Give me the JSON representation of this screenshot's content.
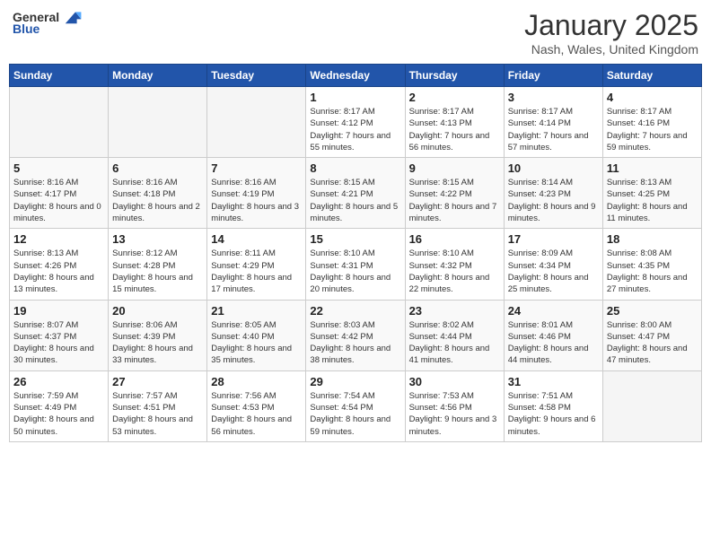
{
  "header": {
    "logo_general": "General",
    "logo_blue": "Blue",
    "month": "January 2025",
    "location": "Nash, Wales, United Kingdom"
  },
  "weekdays": [
    "Sunday",
    "Monday",
    "Tuesday",
    "Wednesday",
    "Thursday",
    "Friday",
    "Saturday"
  ],
  "weeks": [
    [
      {
        "day": "",
        "empty": true
      },
      {
        "day": "",
        "empty": true
      },
      {
        "day": "",
        "empty": true
      },
      {
        "day": "1",
        "sunrise": "8:17 AM",
        "sunset": "4:12 PM",
        "daylight": "7 hours and 55 minutes."
      },
      {
        "day": "2",
        "sunrise": "8:17 AM",
        "sunset": "4:13 PM",
        "daylight": "7 hours and 56 minutes."
      },
      {
        "day": "3",
        "sunrise": "8:17 AM",
        "sunset": "4:14 PM",
        "daylight": "7 hours and 57 minutes."
      },
      {
        "day": "4",
        "sunrise": "8:17 AM",
        "sunset": "4:16 PM",
        "daylight": "7 hours and 59 minutes."
      }
    ],
    [
      {
        "day": "5",
        "sunrise": "8:16 AM",
        "sunset": "4:17 PM",
        "daylight": "8 hours and 0 minutes."
      },
      {
        "day": "6",
        "sunrise": "8:16 AM",
        "sunset": "4:18 PM",
        "daylight": "8 hours and 2 minutes."
      },
      {
        "day": "7",
        "sunrise": "8:16 AM",
        "sunset": "4:19 PM",
        "daylight": "8 hours and 3 minutes."
      },
      {
        "day": "8",
        "sunrise": "8:15 AM",
        "sunset": "4:21 PM",
        "daylight": "8 hours and 5 minutes."
      },
      {
        "day": "9",
        "sunrise": "8:15 AM",
        "sunset": "4:22 PM",
        "daylight": "8 hours and 7 minutes."
      },
      {
        "day": "10",
        "sunrise": "8:14 AM",
        "sunset": "4:23 PM",
        "daylight": "8 hours and 9 minutes."
      },
      {
        "day": "11",
        "sunrise": "8:13 AM",
        "sunset": "4:25 PM",
        "daylight": "8 hours and 11 minutes."
      }
    ],
    [
      {
        "day": "12",
        "sunrise": "8:13 AM",
        "sunset": "4:26 PM",
        "daylight": "8 hours and 13 minutes."
      },
      {
        "day": "13",
        "sunrise": "8:12 AM",
        "sunset": "4:28 PM",
        "daylight": "8 hours and 15 minutes."
      },
      {
        "day": "14",
        "sunrise": "8:11 AM",
        "sunset": "4:29 PM",
        "daylight": "8 hours and 17 minutes."
      },
      {
        "day": "15",
        "sunrise": "8:10 AM",
        "sunset": "4:31 PM",
        "daylight": "8 hours and 20 minutes."
      },
      {
        "day": "16",
        "sunrise": "8:10 AM",
        "sunset": "4:32 PM",
        "daylight": "8 hours and 22 minutes."
      },
      {
        "day": "17",
        "sunrise": "8:09 AM",
        "sunset": "4:34 PM",
        "daylight": "8 hours and 25 minutes."
      },
      {
        "day": "18",
        "sunrise": "8:08 AM",
        "sunset": "4:35 PM",
        "daylight": "8 hours and 27 minutes."
      }
    ],
    [
      {
        "day": "19",
        "sunrise": "8:07 AM",
        "sunset": "4:37 PM",
        "daylight": "8 hours and 30 minutes."
      },
      {
        "day": "20",
        "sunrise": "8:06 AM",
        "sunset": "4:39 PM",
        "daylight": "8 hours and 33 minutes."
      },
      {
        "day": "21",
        "sunrise": "8:05 AM",
        "sunset": "4:40 PM",
        "daylight": "8 hours and 35 minutes."
      },
      {
        "day": "22",
        "sunrise": "8:03 AM",
        "sunset": "4:42 PM",
        "daylight": "8 hours and 38 minutes."
      },
      {
        "day": "23",
        "sunrise": "8:02 AM",
        "sunset": "4:44 PM",
        "daylight": "8 hours and 41 minutes."
      },
      {
        "day": "24",
        "sunrise": "8:01 AM",
        "sunset": "4:46 PM",
        "daylight": "8 hours and 44 minutes."
      },
      {
        "day": "25",
        "sunrise": "8:00 AM",
        "sunset": "4:47 PM",
        "daylight": "8 hours and 47 minutes."
      }
    ],
    [
      {
        "day": "26",
        "sunrise": "7:59 AM",
        "sunset": "4:49 PM",
        "daylight": "8 hours and 50 minutes."
      },
      {
        "day": "27",
        "sunrise": "7:57 AM",
        "sunset": "4:51 PM",
        "daylight": "8 hours and 53 minutes."
      },
      {
        "day": "28",
        "sunrise": "7:56 AM",
        "sunset": "4:53 PM",
        "daylight": "8 hours and 56 minutes."
      },
      {
        "day": "29",
        "sunrise": "7:54 AM",
        "sunset": "4:54 PM",
        "daylight": "8 hours and 59 minutes."
      },
      {
        "day": "30",
        "sunrise": "7:53 AM",
        "sunset": "4:56 PM",
        "daylight": "9 hours and 3 minutes."
      },
      {
        "day": "31",
        "sunrise": "7:51 AM",
        "sunset": "4:58 PM",
        "daylight": "9 hours and 6 minutes."
      },
      {
        "day": "",
        "empty": true
      }
    ]
  ]
}
